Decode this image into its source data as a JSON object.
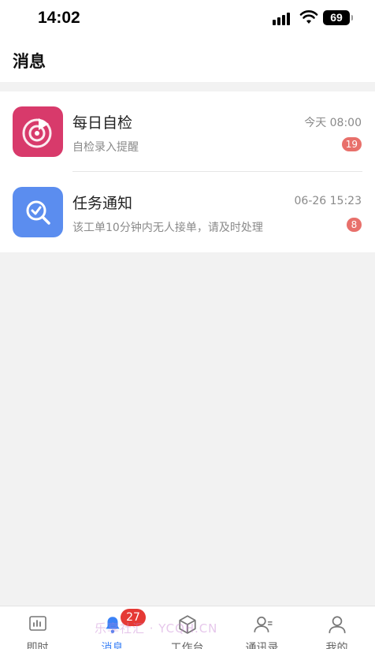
{
  "status_bar": {
    "time": "14:02",
    "battery": "69",
    "icons": [
      "signal-icon",
      "wifi-icon",
      "battery-icon"
    ]
  },
  "header": {
    "title": "消息"
  },
  "messages": [
    {
      "title": "每日自检",
      "time": "今天 08:00",
      "preview": "自检录入提醒",
      "badge": "19",
      "icon": "radar-icon",
      "icon_color": "#d83a6b"
    },
    {
      "title": "任务通知",
      "time": "06-26 15:23",
      "preview": "该工单10分钟内无人接单，请及时处理",
      "badge": "8",
      "icon": "search-check-icon",
      "icon_color": "#5b8def"
    }
  ],
  "tabs": [
    {
      "label": "即时",
      "icon": "chart-icon"
    },
    {
      "label": "消息",
      "icon": "bell-icon",
      "badge": "27",
      "active": true
    },
    {
      "label": "工作台",
      "icon": "cube-icon"
    },
    {
      "label": "通讯录",
      "icon": "contacts-icon"
    },
    {
      "label": "我的",
      "icon": "user-icon"
    }
  ],
  "watermark": "乐享社汇 · YCQH.CN",
  "colors": {
    "accent": "#3b82f6",
    "badge_red": "#e53935",
    "badge_soft": "#e8706b"
  }
}
